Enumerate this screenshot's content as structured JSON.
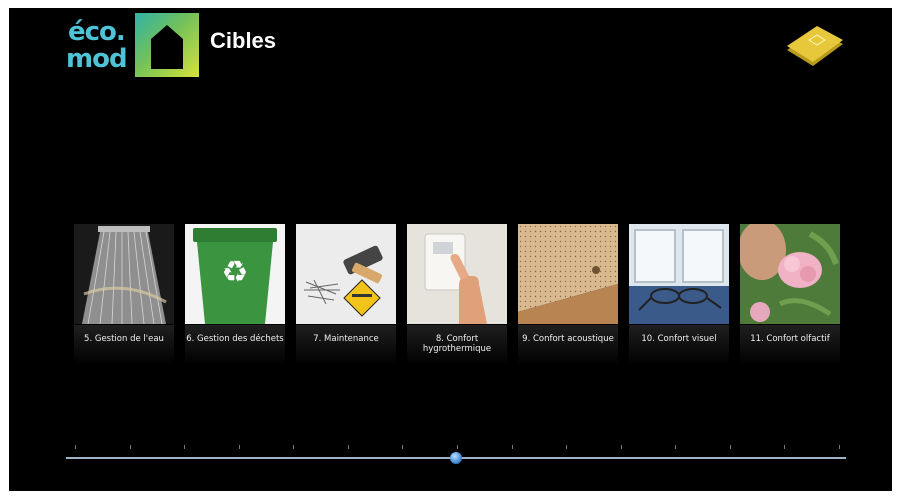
{
  "header": {
    "logo_line1": "éco.",
    "logo_line2": "mod",
    "title": "Cibles"
  },
  "home_icon": "folder-home-icon",
  "cards": [
    {
      "label": "5. Gestion de l'eau",
      "icon": "water-shower-image"
    },
    {
      "label": "6. Gestion des déchets",
      "icon": "recycle-bin-image"
    },
    {
      "label": "7. Maintenance",
      "icon": "maintenance-tools-image"
    },
    {
      "label": "8. Confort hygrothermique",
      "icon": "thermostat-image"
    },
    {
      "label": "9. Confort acoustique",
      "icon": "acoustic-ceiling-image"
    },
    {
      "label": "10. Confort visuel",
      "icon": "glasses-window-image"
    },
    {
      "label": "11. Confort olfactif",
      "icon": "smelling-flower-image"
    }
  ],
  "slider": {
    "tick_count": 15,
    "position_fraction": 0.5
  },
  "colors": {
    "background": "#000000",
    "logo_teal": "#4fc3d6",
    "home_yellow": "#e6c83a",
    "slider_blue": "#4a90d9"
  }
}
